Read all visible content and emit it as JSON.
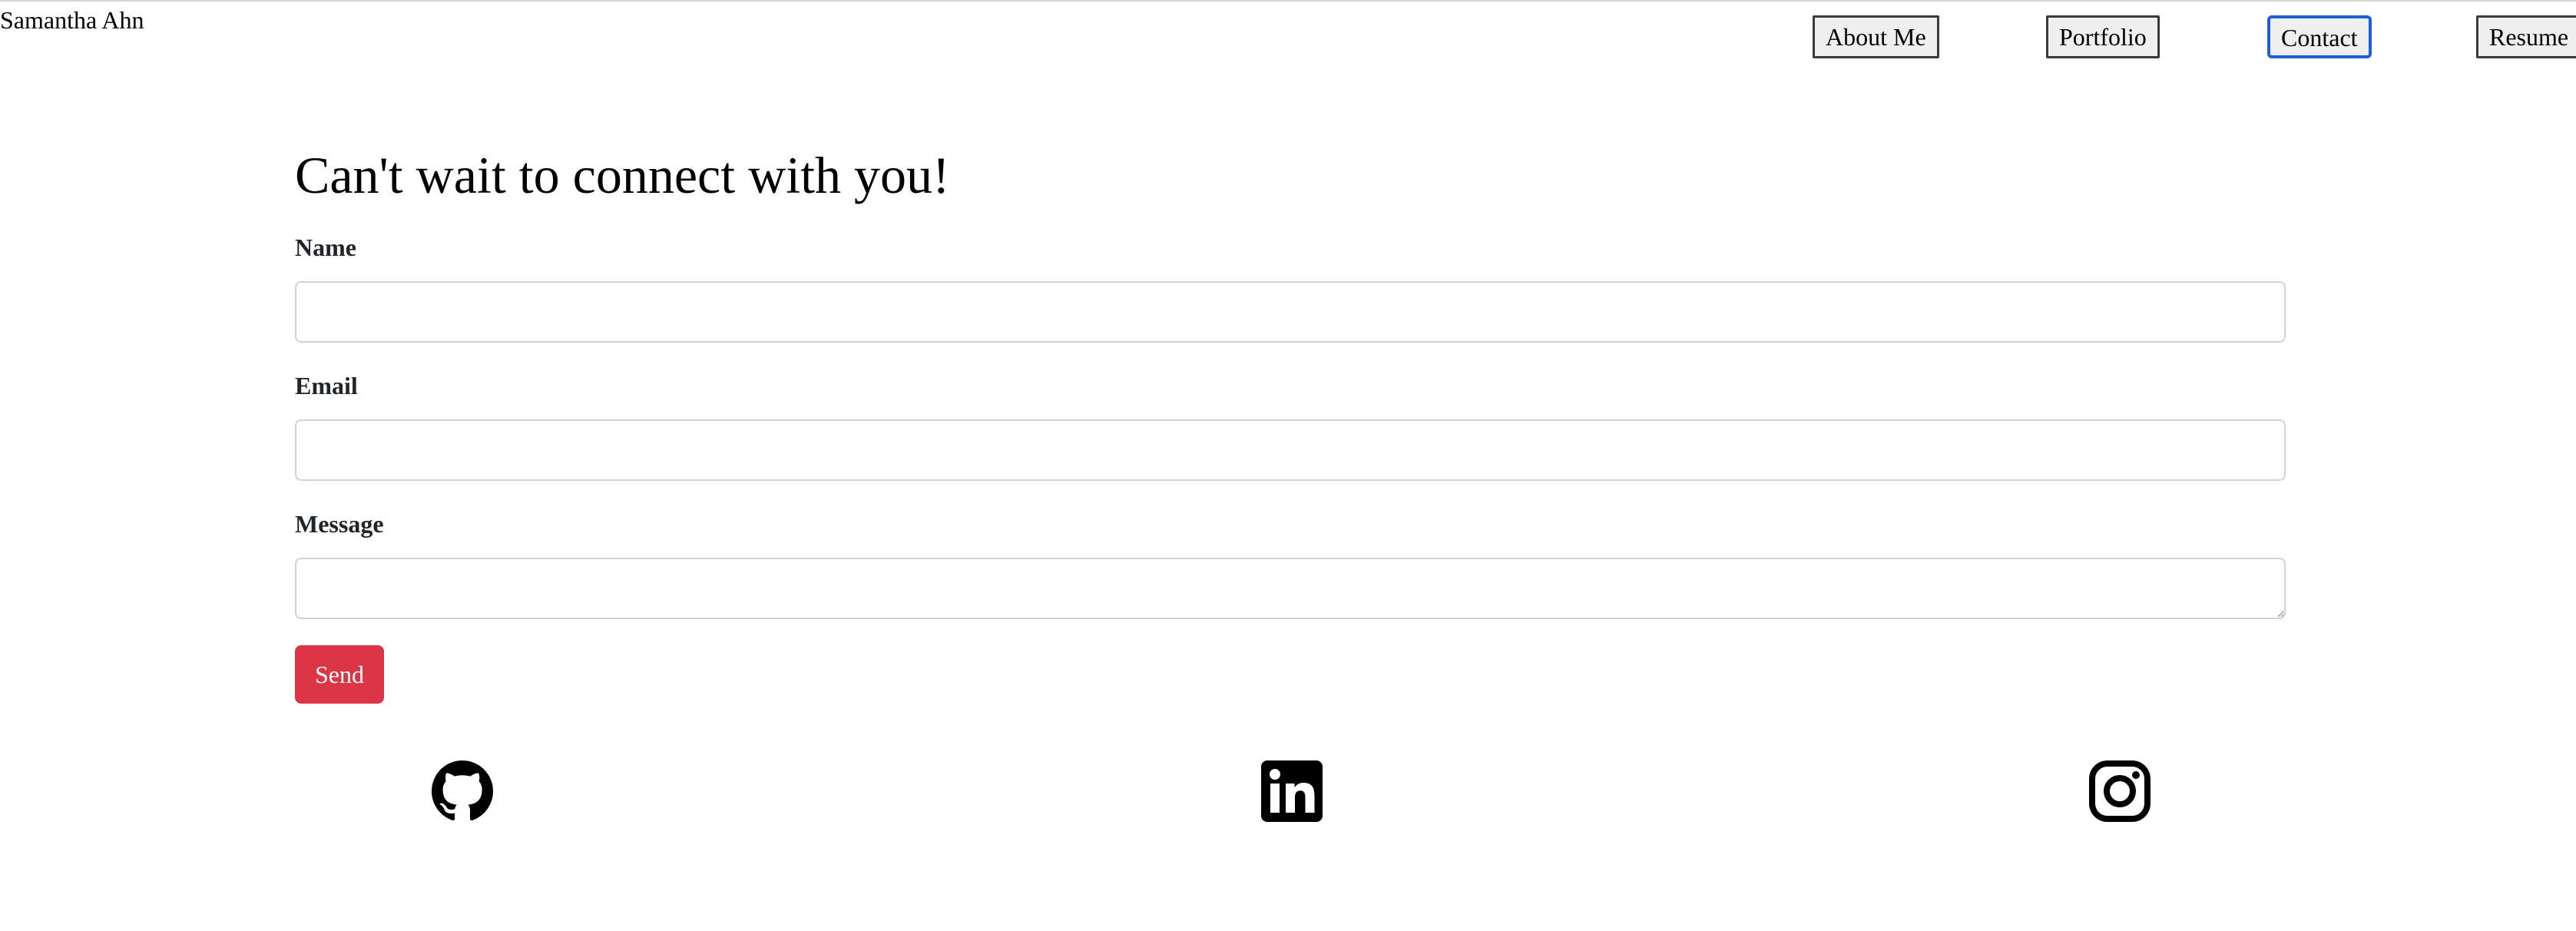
{
  "header": {
    "brand": "Samantha Ahn",
    "nav": [
      {
        "label": "About Me"
      },
      {
        "label": "Portfolio"
      },
      {
        "label": "Contact",
        "active": true
      },
      {
        "label": "Resume"
      }
    ]
  },
  "contact": {
    "heading": "Can't wait to connect with you!",
    "fields": {
      "name": {
        "label": "Name",
        "value": "",
        "placeholder": ""
      },
      "email": {
        "label": "Email",
        "value": "",
        "placeholder": ""
      },
      "message": {
        "label": "Message",
        "value": "",
        "placeholder": ""
      }
    },
    "send_label": "Send"
  },
  "social": [
    {
      "icon": "github-icon"
    },
    {
      "icon": "linkedin-icon"
    },
    {
      "icon": "instagram-icon"
    }
  ],
  "colors": {
    "send_button": "#dc3545",
    "active_nav_border": "#1f5fd6"
  }
}
